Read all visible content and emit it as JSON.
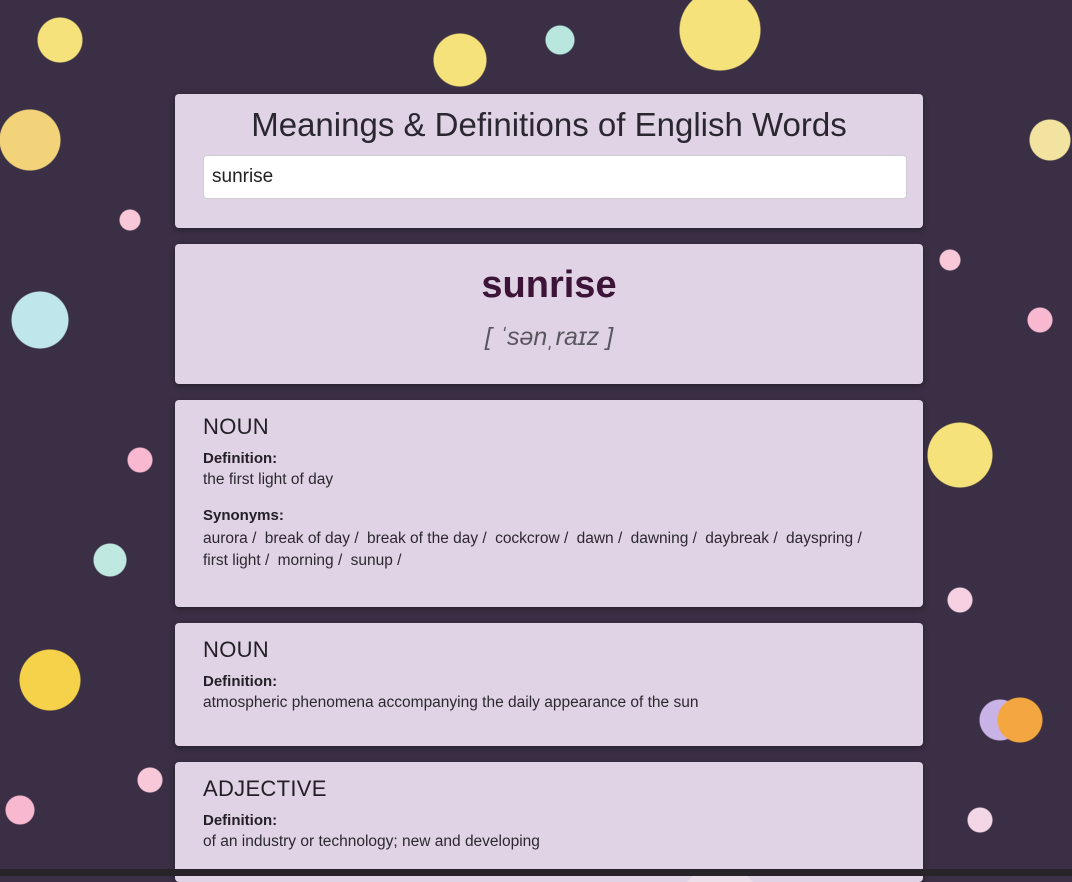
{
  "app": {
    "title": "Meanings & Definitions of English Words",
    "search_value": "sunrise"
  },
  "word": {
    "text": "sunrise",
    "phonetic": "[ ˈsənˌraɪz ]"
  },
  "meanings": [
    {
      "part_of_speech": "NOUN",
      "definition_label": "Definition:",
      "definition": "the first light of day",
      "synonyms_label": "Synonyms:",
      "synonyms": [
        "aurora /",
        "break of day /",
        "break of the day /",
        "cockcrow /",
        "dawn /",
        "dawning /",
        "daybreak /",
        "dayspring /",
        "first light /",
        "morning /",
        "sunup /"
      ]
    },
    {
      "part_of_speech": "NOUN",
      "definition_label": "Definition:",
      "definition": "atmospheric phenomena accompanying the daily appearance of the sun"
    },
    {
      "part_of_speech": "ADJECTIVE",
      "definition_label": "Definition:",
      "definition": "of an industry or technology; new and developing"
    }
  ]
}
